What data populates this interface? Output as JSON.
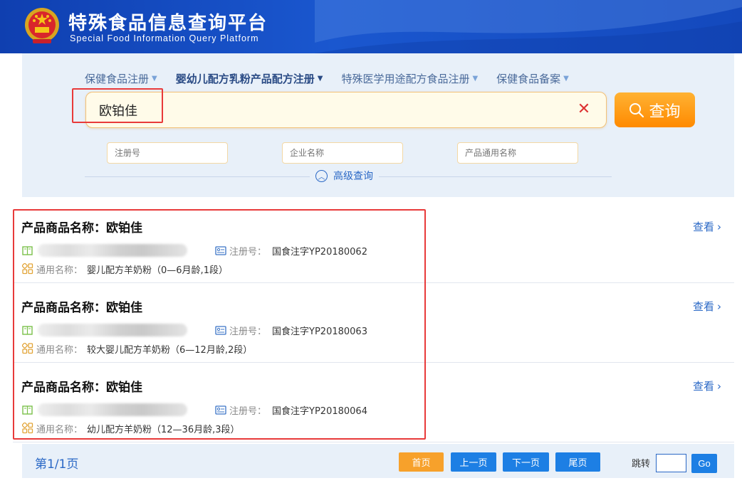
{
  "header": {
    "title": "特殊食品信息查询平台",
    "subtitle": "Special Food Information Query Platform"
  },
  "tabs": [
    {
      "label": "保健食品注册",
      "active": false
    },
    {
      "label": "婴幼儿配方乳粉产品配方注册",
      "active": true
    },
    {
      "label": "特殊医学用途配方食品注册",
      "active": false
    },
    {
      "label": "保健食品备案",
      "active": false
    }
  ],
  "search": {
    "value": "欧铂佳",
    "button_label": "查询",
    "reg_placeholder": "注册号",
    "company_placeholder": "企业名称",
    "generic_placeholder": "产品通用名称",
    "advanced_label": "高级查询"
  },
  "results": [
    {
      "name_label": "产品商品名称：",
      "name": "欧铂佳",
      "view_label": "查看",
      "reg_label": "注册号：",
      "reg_no": "国食注字YP20180062",
      "generic_label": "通用名称：",
      "generic_name": "婴儿配方羊奶粉（0—6月龄,1段）"
    },
    {
      "name_label": "产品商品名称：",
      "name": "欧铂佳",
      "view_label": "查看",
      "reg_label": "注册号：",
      "reg_no": "国食注字YP20180063",
      "generic_label": "通用名称：",
      "generic_name": "较大婴儿配方羊奶粉（6—12月龄,2段）"
    },
    {
      "name_label": "产品商品名称：",
      "name": "欧铂佳",
      "view_label": "查看",
      "reg_label": "注册号：",
      "reg_no": "国食注字YP20180064",
      "generic_label": "通用名称：",
      "generic_name": "幼儿配方羊奶粉（12—36月龄,3段）"
    }
  ],
  "pager": {
    "info": "第1/1页",
    "first": "首页",
    "prev": "上一页",
    "next": "下一页",
    "last": "尾页",
    "jump_label": "跳转",
    "go": "Go"
  },
  "colors": {
    "header_blue": "#1a57cf",
    "accent_blue": "#2a68c6",
    "search_orange": "#ff8a00",
    "highlight_red": "#e83a3a"
  }
}
